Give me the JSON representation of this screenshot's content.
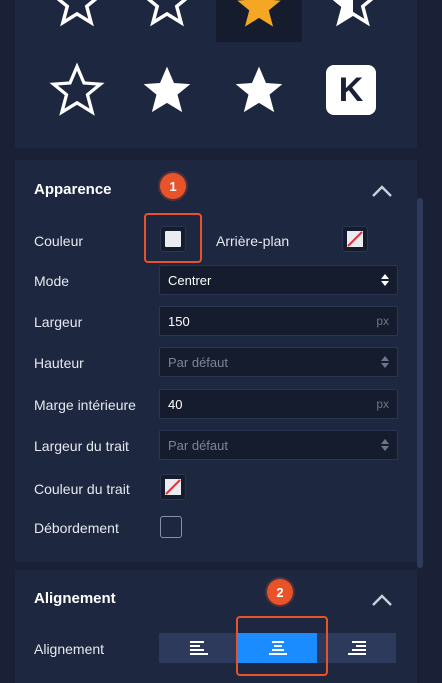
{
  "icon_picker": {
    "icons": [
      "star-outline-icon",
      "star-outline-icon",
      "star-filled-icon",
      "star-outline-icon",
      "star-outline-icon",
      "star-filled-icon",
      "star-filled-icon",
      "kickstarter-icon"
    ],
    "kickstarter_letter": "K",
    "selected_color": "#f5a623"
  },
  "appearance": {
    "title": "Apparence",
    "color_label": "Couleur",
    "background_label": "Arrière-plan",
    "mode_label": "Mode",
    "mode_value": "Centrer",
    "width_label": "Largeur",
    "width_value": "150",
    "width_unit": "px",
    "height_label": "Hauteur",
    "height_placeholder": "Par défaut",
    "padding_label": "Marge intérieure",
    "padding_value": "40",
    "padding_unit": "px",
    "stroke_width_label": "Largeur du trait",
    "stroke_width_placeholder": "Par défaut",
    "stroke_color_label": "Couleur du trait",
    "overflow_label": "Débordement"
  },
  "alignment": {
    "title": "Alignement",
    "label": "Alignement",
    "options": [
      "align-left",
      "align-center",
      "align-right"
    ],
    "active": "align-center"
  },
  "callouts": {
    "one": "1",
    "two": "2"
  },
  "colors": {
    "accent": "#1a8cff",
    "callout": "#e8532a",
    "panel": "#1e2740",
    "background": "#1a2136"
  }
}
